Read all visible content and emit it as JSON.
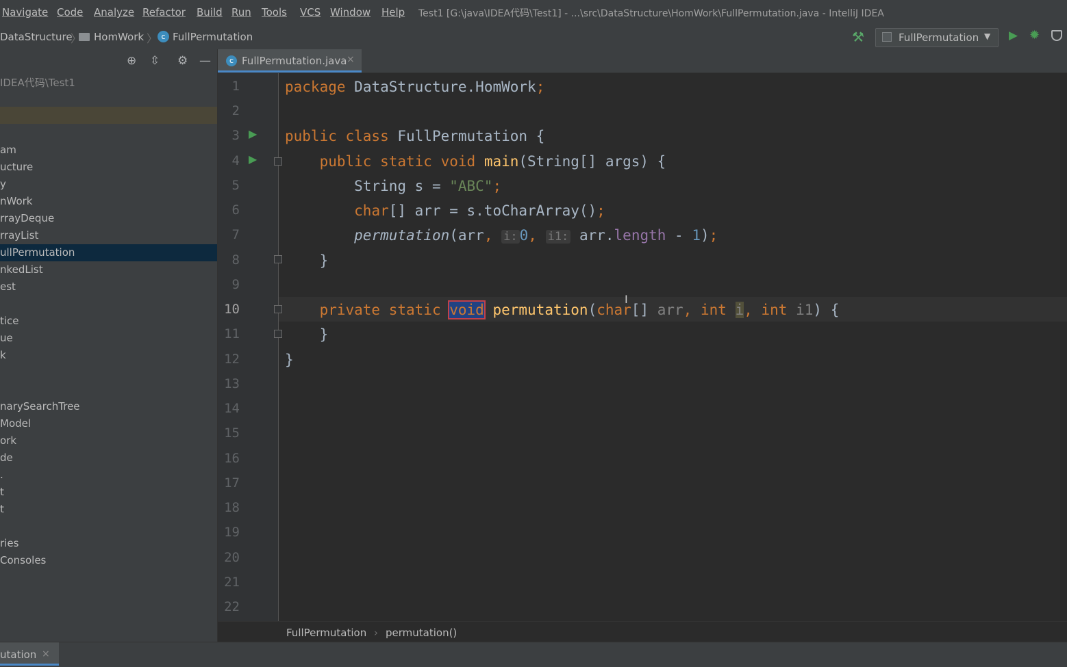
{
  "menu": [
    "Navigate",
    "Code",
    "Analyze",
    "Refactor",
    "Build",
    "Run",
    "Tools",
    "VCS",
    "Window",
    "Help"
  ],
  "window_title": "Test1 [G:\\java\\IDEA代码\\Test1] - ...\\src\\DataStructure\\HomWork\\FullPermutation.java - IntelliJ IDEA",
  "breadcrumb": [
    "DataStructure",
    "HomWork",
    "FullPermutation"
  ],
  "run_config": "FullPermutation",
  "project_panel": {
    "root_path": "IDEA代码\\Test1",
    "items": [
      "am",
      "ucture",
      "y",
      "nWork",
      "rrayDeque",
      "rrayList",
      "ullPermutation",
      "nkedList",
      "est",
      "tice",
      "ue",
      "k",
      "narySearchTree",
      "Model",
      "ork",
      "de",
      ".",
      "t",
      "t",
      "ries",
      " Consoles"
    ]
  },
  "editor_tab": {
    "label": "FullPermutation.java",
    "close": "×"
  },
  "code": {
    "line_numbers": [
      "1",
      "2",
      "3",
      "4",
      "5",
      "6",
      "7",
      "8",
      "9",
      "10",
      "11",
      "12",
      "13",
      "14",
      "15",
      "16",
      "17",
      "18",
      "19",
      "20",
      "21",
      "22"
    ],
    "line1": {
      "kw": "package",
      "name": "DataStructure.HomWork",
      "semi": ";"
    },
    "line3": {
      "kw": "public class",
      "name": "FullPermutation",
      "brace": "{"
    },
    "line4": {
      "kw": "public static void",
      "fn": "main",
      "params": "(String[] args) {"
    },
    "line5": {
      "type": "String s = ",
      "str": "\"ABC\"",
      "semi": ";"
    },
    "line6": {
      "kw": "char",
      "rest": "[] arr = s.toCharArray()",
      "semi": ";"
    },
    "line7": {
      "call": "permutation",
      "open": "(arr",
      "comma1": ",",
      "hint1": "i:",
      "num0": "0",
      "comma2": ",",
      "hint2": "i1:",
      "arr": "arr.",
      "field": "length",
      "minus": " - ",
      "num1": "1",
      "close": ")",
      "semi": ";"
    },
    "line8": "}",
    "line10": {
      "kw": "private static",
      "void": "void",
      "fn": "permutation",
      "open": "(",
      "char": "char",
      "bracket": "[] ",
      "arr": "arr",
      "comma1": ", ",
      "int1": "int",
      "i": "i",
      "comma2": ", ",
      "int2": "int",
      "i1": "i1",
      "close": ") {"
    },
    "line11": "}",
    "line12": "}"
  },
  "editor_breadcrumb": [
    "FullPermutation",
    "permutation()"
  ],
  "bottom_tab": {
    "label": "utation",
    "close": "×"
  }
}
